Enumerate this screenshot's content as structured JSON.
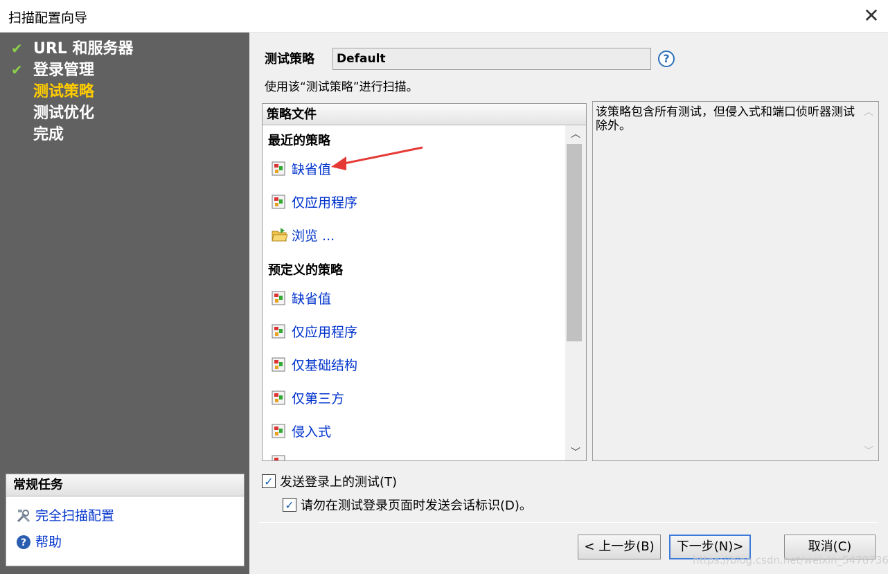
{
  "window": {
    "title": "扫描配置向导",
    "close_glyph": "✕"
  },
  "sidebar": {
    "steps": [
      {
        "label": "URL 和服务器",
        "done": true
      },
      {
        "label": "登录管理",
        "done": true
      },
      {
        "label": "测试策略",
        "done": false,
        "active": true
      },
      {
        "label": "测试优化",
        "done": false
      },
      {
        "label": "完成",
        "done": false
      }
    ],
    "check_glyph": "✔",
    "tasks": {
      "header": "常规任务",
      "items": [
        {
          "label": "完全扫描配置",
          "icon": "tools-icon"
        },
        {
          "label": "帮助",
          "icon": "help-icon"
        }
      ]
    }
  },
  "main": {
    "policy_label": "测试策略",
    "policy_value": "Default",
    "help_glyph": "?",
    "description": "使用该“测试策略”进行扫描。",
    "list": {
      "header": "策略文件",
      "recent_title": "最近的策略",
      "recent_items": [
        "缺省值",
        "仅应用程序",
        "浏览 ..."
      ],
      "predefined_title": "预定义的策略",
      "predefined_items": [
        "缺省值",
        "仅应用程序",
        "仅基础结构",
        "仅第三方",
        "侵入式"
      ]
    },
    "policy_description": "该策略包含所有测试，但侵入式和端口侦听器测试除外。",
    "checkboxes": [
      {
        "label": "发送登录上的测试(T)",
        "checked": true
      },
      {
        "label": "请勿在测试登录页面时发送会话标识(D)。",
        "checked": true
      }
    ],
    "buttons": {
      "back": "< 上一步(B)",
      "next": "下一步(N)>",
      "cancel": "取消(C)"
    }
  },
  "watermark": "https://blog.csdn.net/weixin_54787369",
  "colors": {
    "active_step": "#ffcc00",
    "link": "#0033cc",
    "sidebar_bg": "#616161",
    "check": "#8ccf4c",
    "arrow": "#e53935"
  }
}
